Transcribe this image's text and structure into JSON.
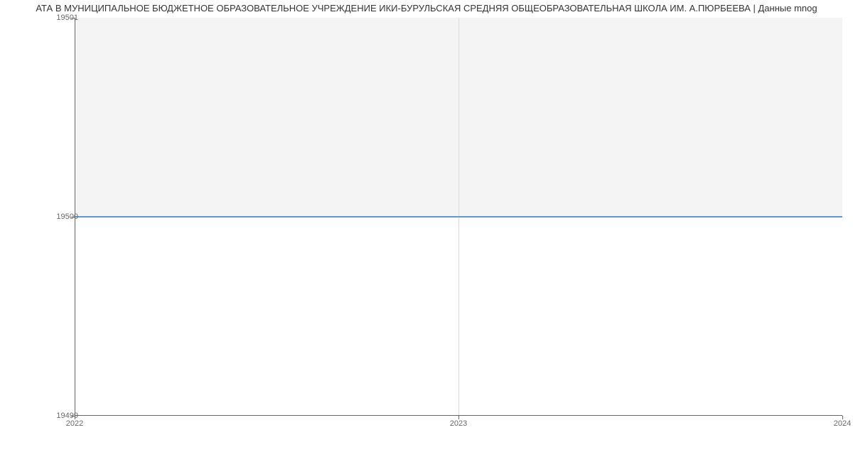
{
  "chart_data": {
    "type": "line",
    "title": "АТА В МУНИЦИПАЛЬНОЕ БЮДЖЕТНОЕ ОБРАЗОВАТЕЛЬНОЕ УЧРЕЖДЕНИЕ ИКИ-БУРУЛЬСКАЯ СРЕДНЯЯ ОБЩЕОБРАЗОВАТЕЛЬНАЯ ШКОЛА ИМ. А.ПЮРБЕЕВА | Данные mnog",
    "x": [
      2022,
      2023,
      2024
    ],
    "values": [
      19500,
      19500,
      19500
    ],
    "xlabel": "",
    "ylabel": "",
    "ylim": [
      19499,
      19501
    ],
    "xlim": [
      2022,
      2024
    ],
    "y_ticks": [
      19499,
      19500,
      19501
    ],
    "x_ticks": [
      2022,
      2023,
      2024
    ]
  }
}
